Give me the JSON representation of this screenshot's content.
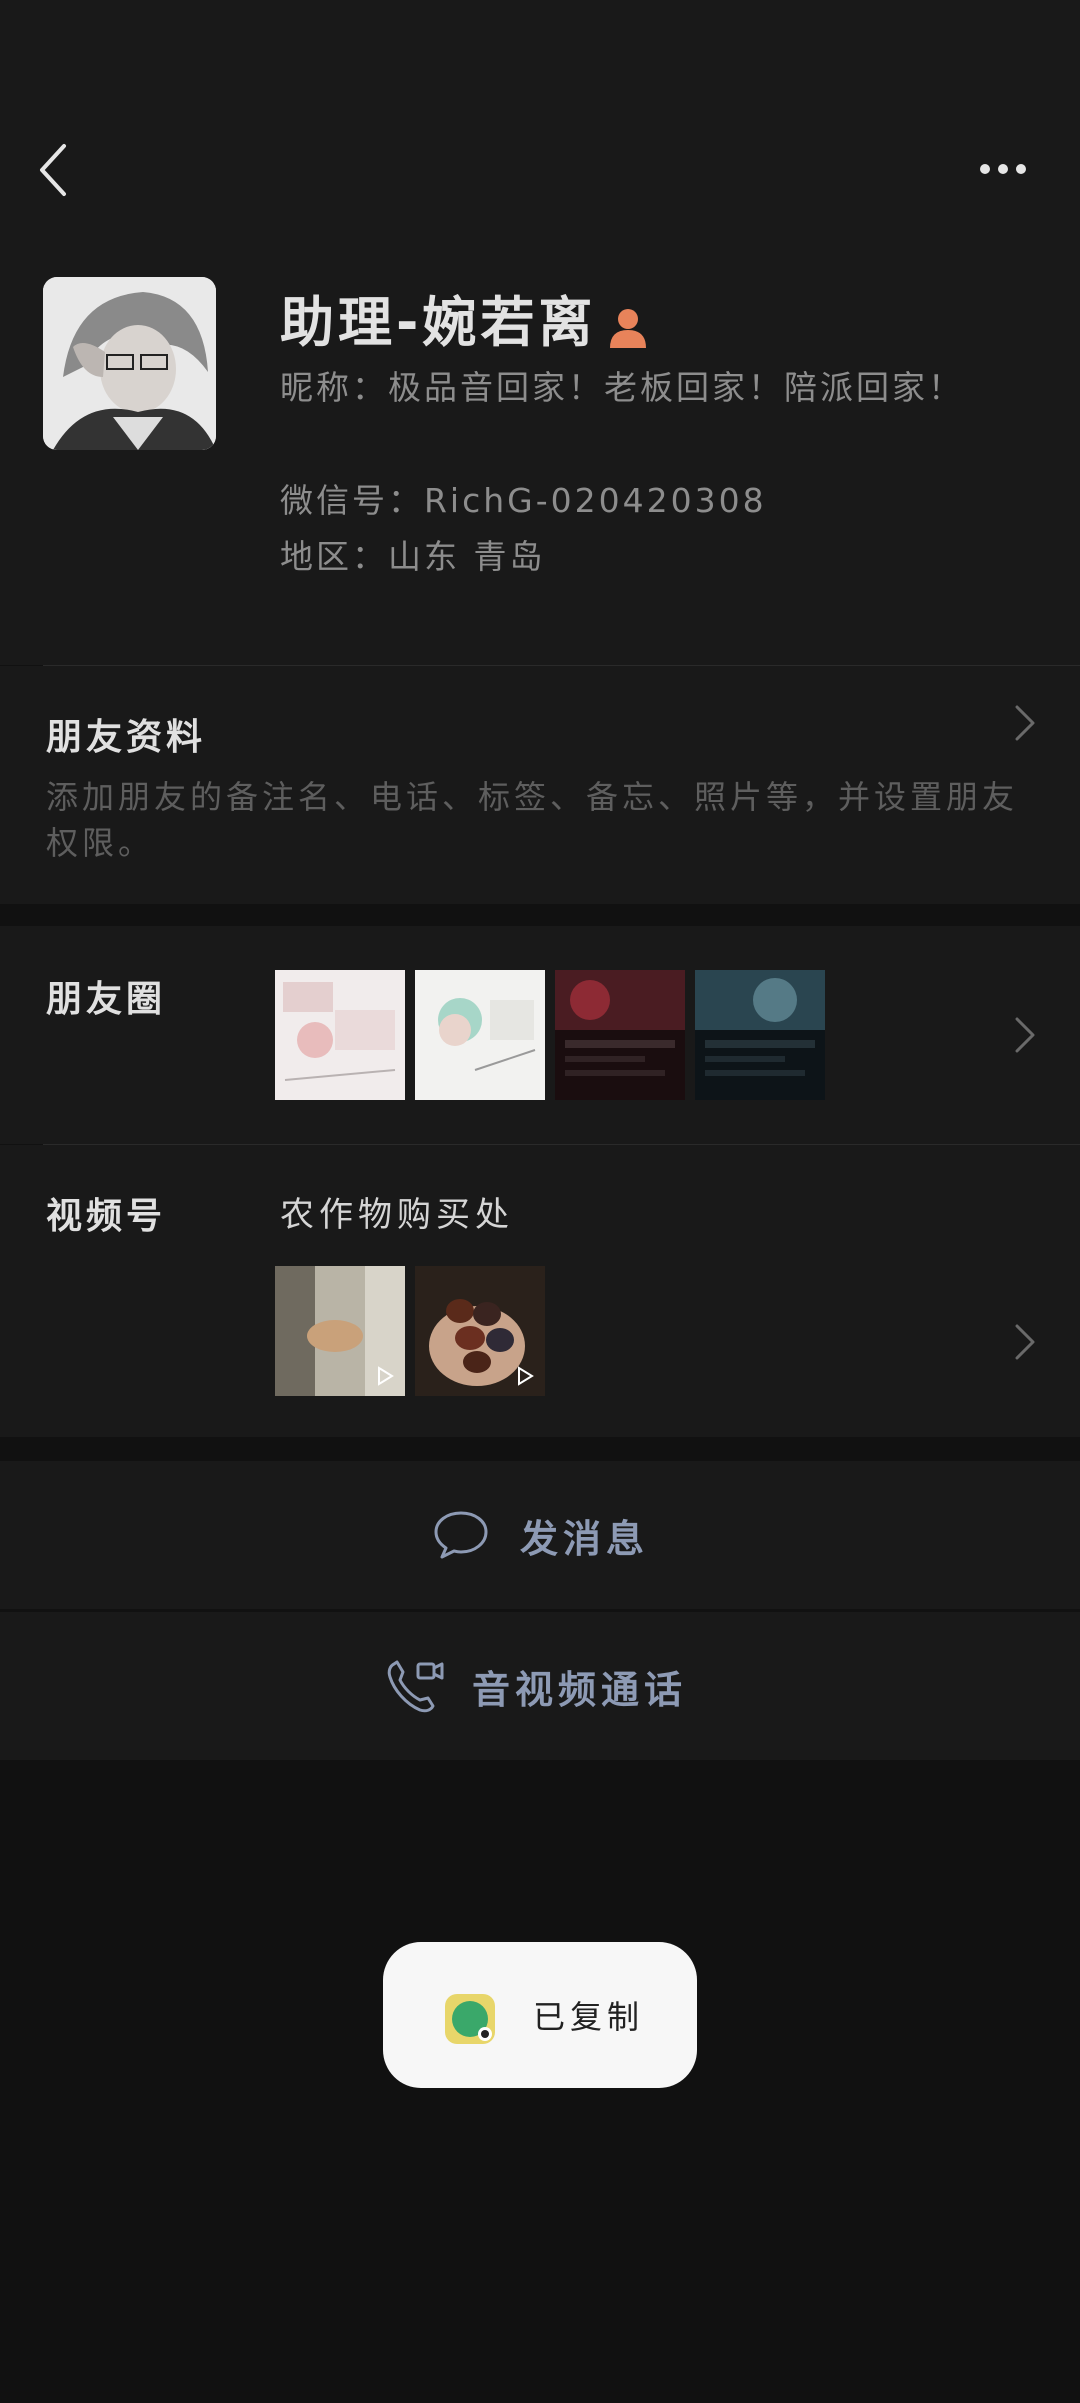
{
  "header": {
    "back_icon": "chevron-left-icon",
    "more_icon": "more-dots-icon"
  },
  "profile": {
    "display_name": "助理-婉若离",
    "nickname": "昵称：极品音回家！老板回家！陪派回家！",
    "wechat_id": "微信号：RichG-020420308",
    "region": "地区：山东 青岛"
  },
  "friend_info": {
    "title": "朋友资料",
    "description": "添加朋友的备注名、电话、标签、备忘、照片等，并设置朋友权限。"
  },
  "moments": {
    "title": "朋友圈"
  },
  "channels": {
    "title": "视频号",
    "name": "农作物购买处"
  },
  "actions": {
    "message_label": "发消息",
    "call_label": "音视频通话"
  },
  "toast": {
    "label": "已复制"
  },
  "colors": {
    "background": "#111111",
    "card": "#191919",
    "action_text": "#8d9ab4",
    "toast_bg": "#f7f7f7"
  }
}
